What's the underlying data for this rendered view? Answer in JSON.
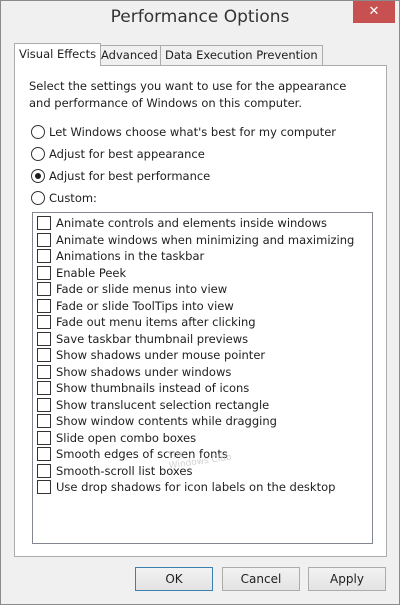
{
  "window": {
    "title": "Performance Options",
    "close_glyph": "✕"
  },
  "tabs": [
    {
      "label": "Visual Effects",
      "active": true
    },
    {
      "label": "Advanced",
      "active": false
    },
    {
      "label": "Data Execution Prevention",
      "active": false
    }
  ],
  "panel": {
    "description": "Select the settings you want to use for the appearance and performance of Windows on this computer.",
    "options": [
      {
        "label": "Let Windows choose what's best for my computer",
        "selected": false
      },
      {
        "label": "Adjust for best appearance",
        "selected": false
      },
      {
        "label": "Adjust for best performance",
        "selected": true
      },
      {
        "label": "Custom:",
        "selected": false
      }
    ],
    "effects": [
      {
        "label": "Animate controls and elements inside windows",
        "checked": false
      },
      {
        "label": "Animate windows when minimizing and maximizing",
        "checked": false
      },
      {
        "label": "Animations in the taskbar",
        "checked": false
      },
      {
        "label": "Enable Peek",
        "checked": false
      },
      {
        "label": "Fade or slide menus into view",
        "checked": false
      },
      {
        "label": "Fade or slide ToolTips into view",
        "checked": false
      },
      {
        "label": "Fade out menu items after clicking",
        "checked": false
      },
      {
        "label": "Save taskbar thumbnail previews",
        "checked": false
      },
      {
        "label": "Show shadows under mouse pointer",
        "checked": false
      },
      {
        "label": "Show shadows under windows",
        "checked": false
      },
      {
        "label": "Show thumbnails instead of icons",
        "checked": false
      },
      {
        "label": "Show translucent selection rectangle",
        "checked": false
      },
      {
        "label": "Show window contents while dragging",
        "checked": false
      },
      {
        "label": "Slide open combo boxes",
        "checked": false
      },
      {
        "label": "Smooth edges of screen fonts",
        "checked": false
      },
      {
        "label": "Smooth-scroll list boxes",
        "checked": false
      },
      {
        "label": "Use drop shadows for icon labels on the desktop",
        "checked": false
      }
    ],
    "watermark": "The\nWindows Club"
  },
  "buttons": {
    "ok": "OK",
    "cancel": "Cancel",
    "apply": "Apply"
  },
  "colors": {
    "close_button": "#c75050",
    "default_button_border": "#3c7fb1"
  }
}
